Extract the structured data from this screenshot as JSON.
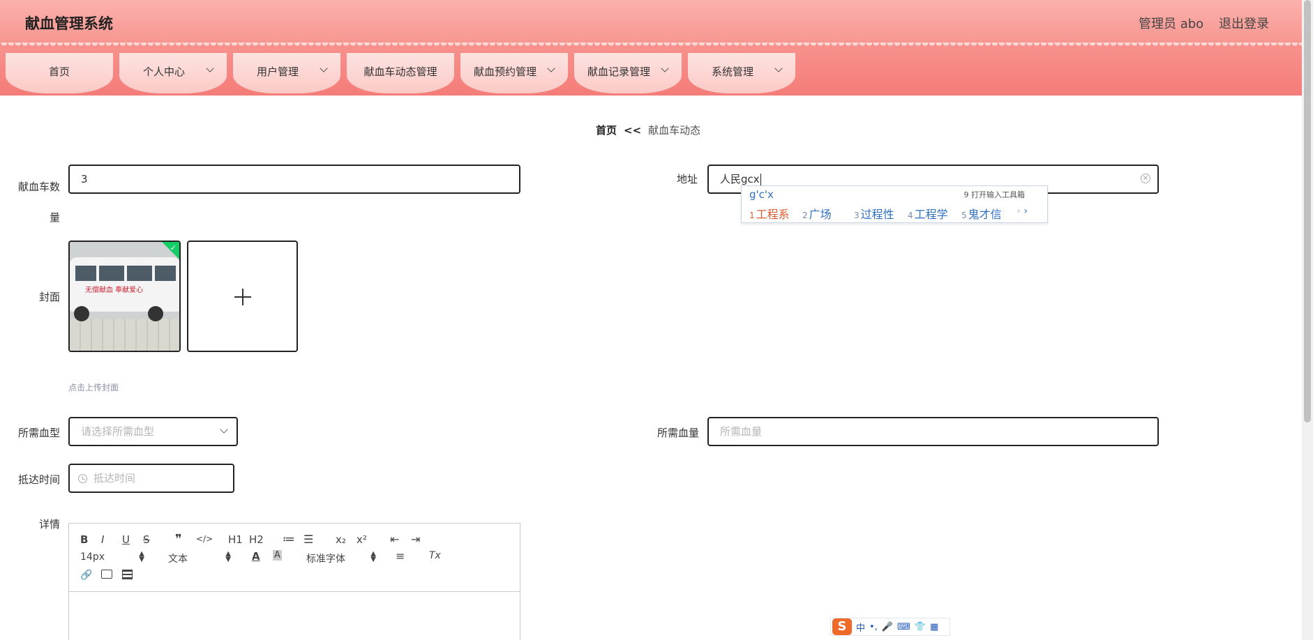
{
  "header": {
    "app_title": "献血管理系统",
    "admin_label": "管理员 abo",
    "logout_label": "退出登录"
  },
  "nav": {
    "items": [
      {
        "label": "首页"
      },
      {
        "label": "个人中心"
      },
      {
        "label": "用户管理"
      },
      {
        "label": "献血车动态管理"
      },
      {
        "label": "献血预约管理"
      },
      {
        "label": "献血记录管理"
      },
      {
        "label": "系统管理"
      }
    ]
  },
  "breadcrumb": {
    "home": "首页",
    "separator": "<<",
    "current": "献血车动态"
  },
  "form": {
    "car_count_label": "献血车数量",
    "car_count_value": "3",
    "address_label": "地址",
    "address_value": "人民gcx",
    "cover_label": "封面",
    "cover_image_text": "无偿献血 奉献爱心",
    "upload_hint": "点击上传封面",
    "blood_type_label": "所需血型",
    "blood_type_placeholder": "请选择所需血型",
    "blood_amount_label": "所需血量",
    "blood_amount_placeholder": "所需血量",
    "arrival_time_label": "抵达时间",
    "arrival_time_placeholder": "抵达时间",
    "detail_label": "详情"
  },
  "editor": {
    "buttons": [
      "B",
      "I",
      "U",
      "S",
      "❞",
      "</>",
      "H1",
      "H2",
      "≔",
      "☰",
      "x₂",
      "x²",
      "⇤",
      "⇥"
    ],
    "font_size": "14px",
    "header_select": "文本",
    "font_family": "标准字体",
    "align_icon": "≡",
    "clear_icon": "Tx"
  },
  "ime": {
    "pinyin": "g'c'x",
    "toolbox_label": "9 打开输入工具箱",
    "candidates": [
      {
        "num": "1",
        "text": "工程系"
      },
      {
        "num": "2",
        "text": "广场"
      },
      {
        "num": "3",
        "text": "过程性"
      },
      {
        "num": "4",
        "text": "工程学"
      },
      {
        "num": "5",
        "text": "鬼才信"
      }
    ],
    "nav_prev": "‹",
    "nav_next": "›",
    "status_logo": "S",
    "status_mode": "中",
    "status_punct": "•,"
  }
}
